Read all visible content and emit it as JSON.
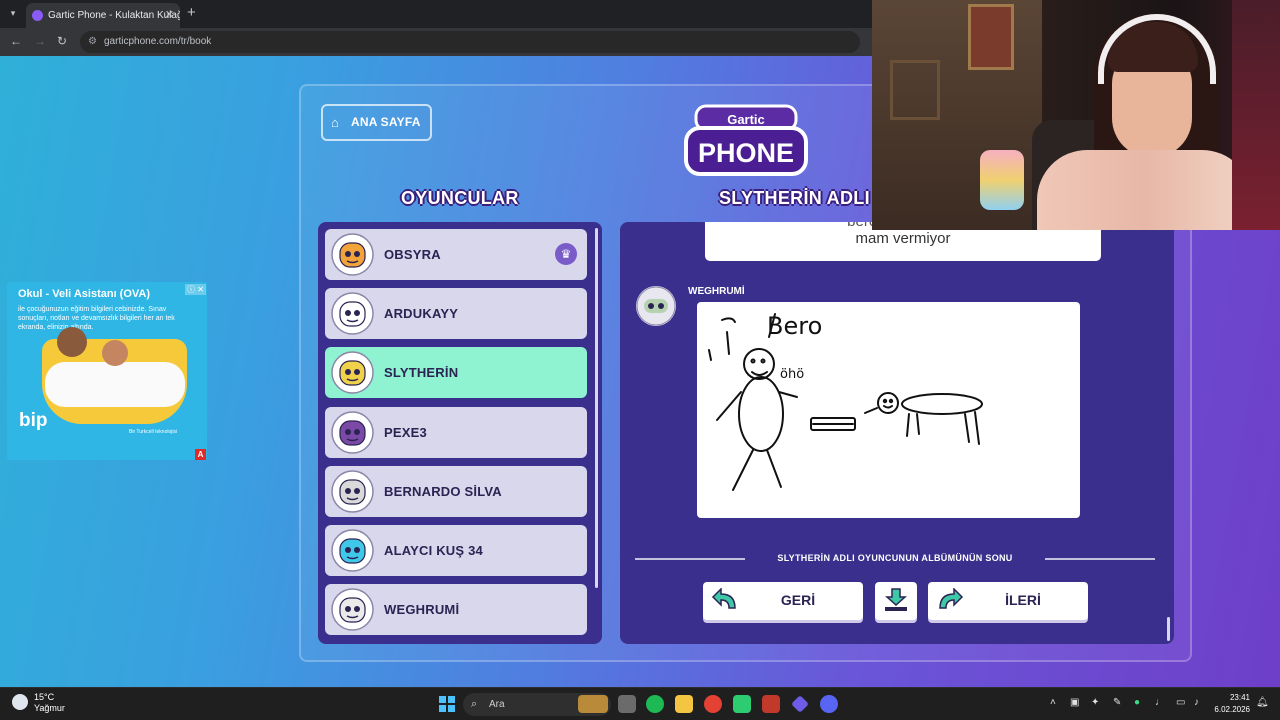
{
  "browser": {
    "tab_title": "Gartic Phone - Kulaktan Kulağa",
    "url": "garticphone.com/tr/book"
  },
  "ad": {
    "title": "Okul - Veli Asistanı (OVA)",
    "text": "ile çocuğunuzun eğitim bilgileri cebinizde. Sınav sonuçları, notları ve devamsızlık bilgileri her an tek ekranda, elinizin altında.",
    "brand": "bip",
    "footer": "Bir Turkcell teknolojisi",
    "badge": "A"
  },
  "game": {
    "home_button": "ANA SAYFA",
    "logo_top": "Gartic",
    "logo_bottom": "PHONE",
    "players_title": "OYUNCULAR",
    "album_title": "SLYTHERİN ADLI",
    "players": [
      {
        "name": "OBSYRA",
        "host": true,
        "active": false,
        "color": "#f2a33a"
      },
      {
        "name": "ARDUKAYY",
        "host": false,
        "active": false,
        "color": "#ffffff"
      },
      {
        "name": "SLYTHERİN",
        "host": false,
        "active": true,
        "color": "#f0d24a"
      },
      {
        "name": "PEXE3",
        "host": false,
        "active": false,
        "color": "#7a4aa6"
      },
      {
        "name": "BERNARDO SİLVA",
        "host": false,
        "active": false,
        "color": "#d9d9d9"
      },
      {
        "name": "ALAYCI KUŞ 34",
        "host": false,
        "active": false,
        "color": "#3fc8e8"
      },
      {
        "name": "WEGHRUMİ",
        "host": false,
        "active": false,
        "color": "#eaeaea"
      }
    ],
    "bubble_line1": "bero öksürüyor k",
    "bubble_line2": "mam vermiyor",
    "drawing_author": "WEGHRUMİ",
    "drawing_text": "Bero",
    "drawing_small_text": "öhö",
    "album_end": "SLYTHERİN ADLI OYUNCUNUN ALBÜMÜNÜN SONU",
    "back_button": "GERİ",
    "next_button": "İLERİ"
  },
  "taskbar": {
    "temperature": "15°C",
    "weather": "Yağmur",
    "search_placeholder": "Ara",
    "time": "23:41",
    "date": "6.02.2026"
  },
  "colors": {
    "accent": "#8ff3d2",
    "panel": "#3a2f8c",
    "title_outline": "#3a1f7e"
  }
}
